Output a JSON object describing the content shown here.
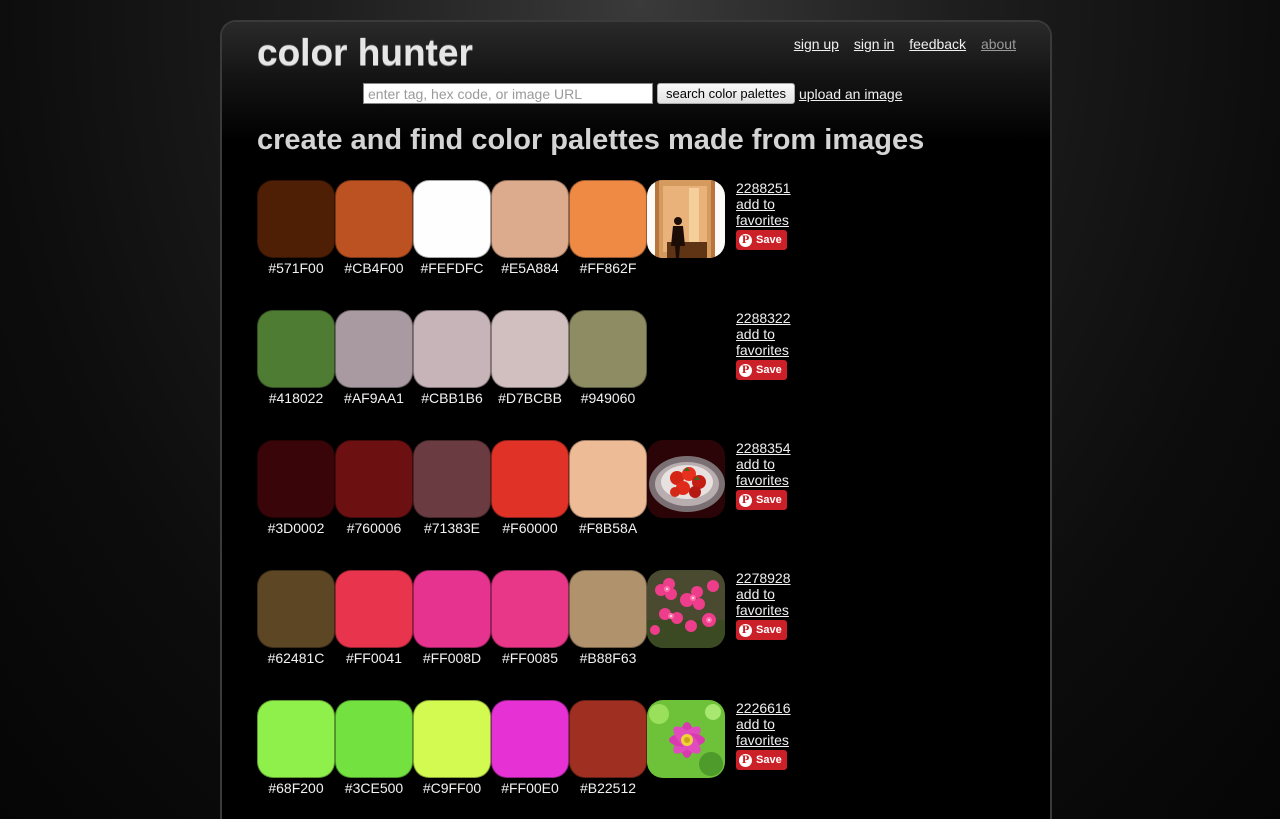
{
  "header": {
    "logo": "color hunter",
    "nav": [
      {
        "label": "sign up"
      },
      {
        "label": "sign in"
      },
      {
        "label": "feedback"
      },
      {
        "label": "about"
      }
    ]
  },
  "search": {
    "placeholder": "enter tag, hex code, or image URL",
    "button_label": "search color palettes",
    "upload_label": "upload an image"
  },
  "headline": "create and find color palettes made from images",
  "palettes": [
    {
      "id": "2288251",
      "favorites_label": "add to favorites",
      "save_label": "Save",
      "colors": [
        "#571F00",
        "#CB4F00",
        "#FEFDFC",
        "#E5A884",
        "#FF862F"
      ]
    },
    {
      "id": "2288322",
      "favorites_label": "add to favorites",
      "save_label": "Save",
      "colors": [
        "#418022",
        "#AF9AA1",
        "#CBB1B6",
        "#D7BCBB",
        "#949060"
      ]
    },
    {
      "id": "2288354",
      "favorites_label": "add to favorites",
      "save_label": "Save",
      "colors": [
        "#3D0002",
        "#760006",
        "#71383E",
        "#F60000",
        "#F8B58A"
      ]
    },
    {
      "id": "2278928",
      "favorites_label": "add to favorites",
      "save_label": "Save",
      "colors": [
        "#62481C",
        "#FF0041",
        "#FF008D",
        "#FF0085",
        "#B88F63"
      ]
    },
    {
      "id": "2226616",
      "favorites_label": "add to favorites",
      "save_label": "Save",
      "colors": [
        "#68F200",
        "#3CE500",
        "#C9FF00",
        "#FF00E0",
        "#B22512"
      ]
    }
  ],
  "display_colors": {
    "p0": [
      "#4f1f05",
      "#bc5222",
      "#fefefe",
      "#dcab8d",
      "#ef8a45"
    ],
    "p1": [
      "#4f7c33",
      "#a89aa0",
      "#c7b4b8",
      "#d1bebe",
      "#8d8c62"
    ],
    "p2": [
      "#3a0508",
      "#6c1012",
      "#6a3b40",
      "#e03226",
      "#eebb97"
    ],
    "p3": [
      "#5d4623",
      "#e8344c",
      "#e6338f",
      "#e83789",
      "#b0926c"
    ],
    "p4": [
      "#8fef4b",
      "#73e241",
      "#d3fa50",
      "#e632d5",
      "#9f3021"
    ]
  }
}
